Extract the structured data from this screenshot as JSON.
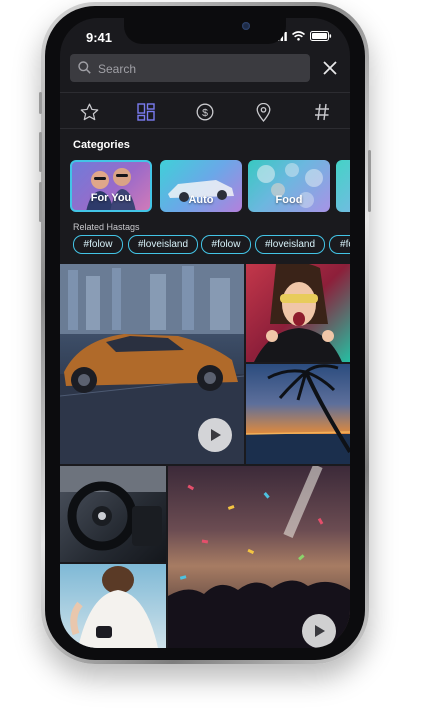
{
  "status": {
    "time": "9:41"
  },
  "search": {
    "placeholder": "Search"
  },
  "tabs": [
    {
      "icon": "star-icon"
    },
    {
      "icon": "grid-icon"
    },
    {
      "icon": "dollar-icon"
    },
    {
      "icon": "location-pin-icon"
    },
    {
      "icon": "hashtag-icon"
    }
  ],
  "categories": {
    "title": "Categories",
    "items": [
      {
        "label": "For You"
      },
      {
        "label": "Auto"
      },
      {
        "label": "Food"
      }
    ]
  },
  "hashtags": {
    "title": "Related Hastags",
    "items": [
      "#folow",
      "#loveisland",
      "#folow",
      "#loveisland",
      "#fo"
    ]
  },
  "colors": {
    "accent": "#43c4e6",
    "background": "#1a1a1e",
    "search_bg": "#3b3b40"
  }
}
